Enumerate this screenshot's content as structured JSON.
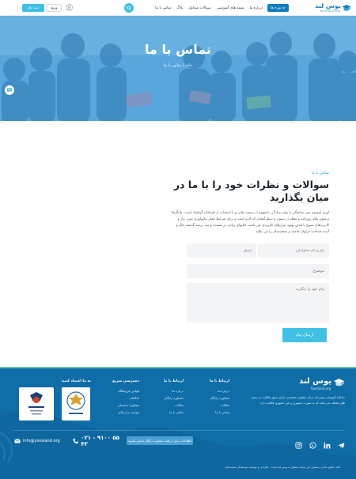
{
  "header": {
    "brand": "یوس لند",
    "brand_sub": "Yousland.org",
    "course_pill": "دوره ها",
    "nav": [
      "درباره ما",
      "بسته های آموزشی",
      "سوالات متداول",
      "بلاگ",
      "تماس با ما"
    ],
    "login": "ورود",
    "signup": "ثبت نام"
  },
  "hero": {
    "title": "تماس با ما",
    "breadcrumb": "خانه  /  تماس با ما"
  },
  "contact": {
    "eyebrow": "تماس با ما",
    "title": "سوالات و نظرات خود را با ما در میان بگذارید",
    "lead": "لورم ایپسوم متن ساختگی با تولید سادگی نامفهوم از صنعت چاپ و با استفاده از طراحان گرافیک است. چاپگرها و متون بلکه روزنامه و مجله در ستون و سطرآنچنان که لازم است و برای شرایط فعلی تکنولوژی مورد نیاز و کاربردهای متنوع با هدف بهبود ابزارهای کاربردی می باشد. کتابهای زیادی در شصت و سه درصد گذشته حال و آینده شناخت فراوان جامعه و متخصصان را می طلبد.",
    "name_placeholder": "نام و نام خانوادگی",
    "email_placeholder": "ایمیل",
    "subject_placeholder": "موضوع",
    "message_placeholder": "پیام خود را بنگارید",
    "send": "ارسال پیام"
  },
  "footer": {
    "brand": "یوس لند",
    "brand_sub": "Yousland.org",
    "about": "سامانه آموزشی یوس لند مرکز مشاوره تخصصی دارای مجوز فعالیت در زمینه های مختلف می باشد که به صورت حضوری و غیر حضوری فعالیت دارد.",
    "col1": {
      "heading": "ارتباط با ما",
      "items": [
        "درباره ما",
        "مشاوره رایگان",
        "مقالات",
        "تماس با ما"
      ]
    },
    "col2": {
      "heading": "ارتباط با ما",
      "items": [
        "درباره ما",
        "مشاوره رایگان",
        "مقالات",
        "تماس با ما"
      ]
    },
    "col3": {
      "heading": "دسترسی سریع",
      "items": [
        "قوانین فروشگاه",
        "امکانات",
        "مشاوره تحصیلی",
        "پیوست و ارتقای"
      ]
    },
    "trust_title": "به ما اعتماد کنید:",
    "cta": "اطلاعات برای دریافت مشاوره رایگان تماس بگیرید",
    "phone": "۰۲۱ - ۹۱۰۰ ۵۵ ۴۳",
    "email": "info@yoosland.org",
    "copyright": "کلیه حقوق مادی و معنوی این سایت متعلق به یوس لند است  ·  طراحی و توسعه: توسعه‌گر بسته‌بندان"
  },
  "colors": {
    "primary": "#0e7cc0",
    "accent": "#3fc1e6",
    "footer": "#0f6ea8",
    "heading": "#1f2530"
  },
  "icons": [
    "graduation-cap-icon",
    "search-icon",
    "user-icon",
    "chat-icon",
    "telegram-icon",
    "linkedin-icon",
    "whatsapp-icon",
    "instagram-icon",
    "phone-icon",
    "email-icon",
    "chevron-down-icon"
  ]
}
